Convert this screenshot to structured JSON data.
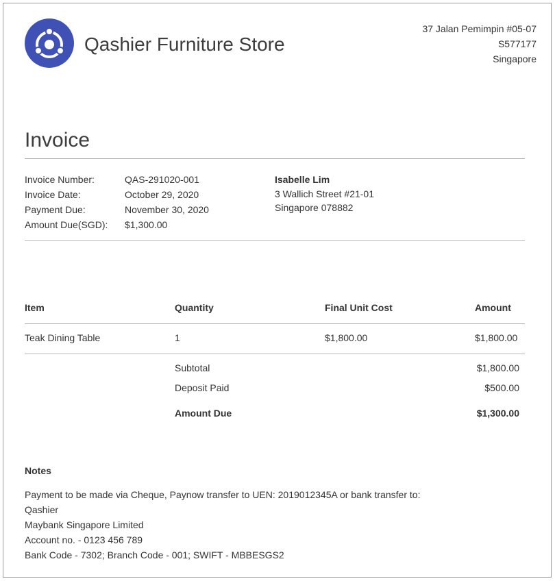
{
  "header": {
    "store_name": "Qashier Furniture Store",
    "address_lines": [
      "37 Jalan Pemimpin #05-07",
      "S577177",
      "Singapore"
    ],
    "logo_color": "#3f51b5"
  },
  "invoice": {
    "title": "Invoice",
    "meta": [
      {
        "label": "Invoice Number:",
        "value": "QAS-291020-001"
      },
      {
        "label": "Invoice Date:",
        "value": "October 29, 2020"
      },
      {
        "label": "Payment Due:",
        "value": "November 30, 2020"
      },
      {
        "label": "Amount Due(SGD):",
        "value": "$1,300.00"
      }
    ]
  },
  "bill_to": {
    "name": "Isabelle Lim",
    "address_lines": [
      "3 Wallich Street #21-01",
      "Singapore 078882"
    ]
  },
  "table": {
    "headers": {
      "item": "Item",
      "quantity": "Quantity",
      "unit_cost": "Final Unit Cost",
      "amount": "Amount"
    },
    "rows": [
      {
        "item": "Teak Dining Table",
        "quantity": "1",
        "unit_cost": "$1,800.00",
        "amount": "$1,800.00"
      }
    ]
  },
  "totals": [
    {
      "label": "Subtotal",
      "value": "$1,800.00"
    },
    {
      "label": "Deposit Paid",
      "value": "$500.00"
    },
    {
      "label": "Amount Due",
      "value": "$1,300.00"
    }
  ],
  "notes": {
    "title": "Notes",
    "lines": [
      "Payment to be made via Cheque, Paynow transfer to UEN: 2019012345A or bank transfer to:",
      "Qashier",
      "Maybank Singapore Limited",
      "Account no. - 0123 456 789",
      "Bank Code - 7302; Branch Code - 001; SWIFT - MBBESGS2"
    ]
  }
}
